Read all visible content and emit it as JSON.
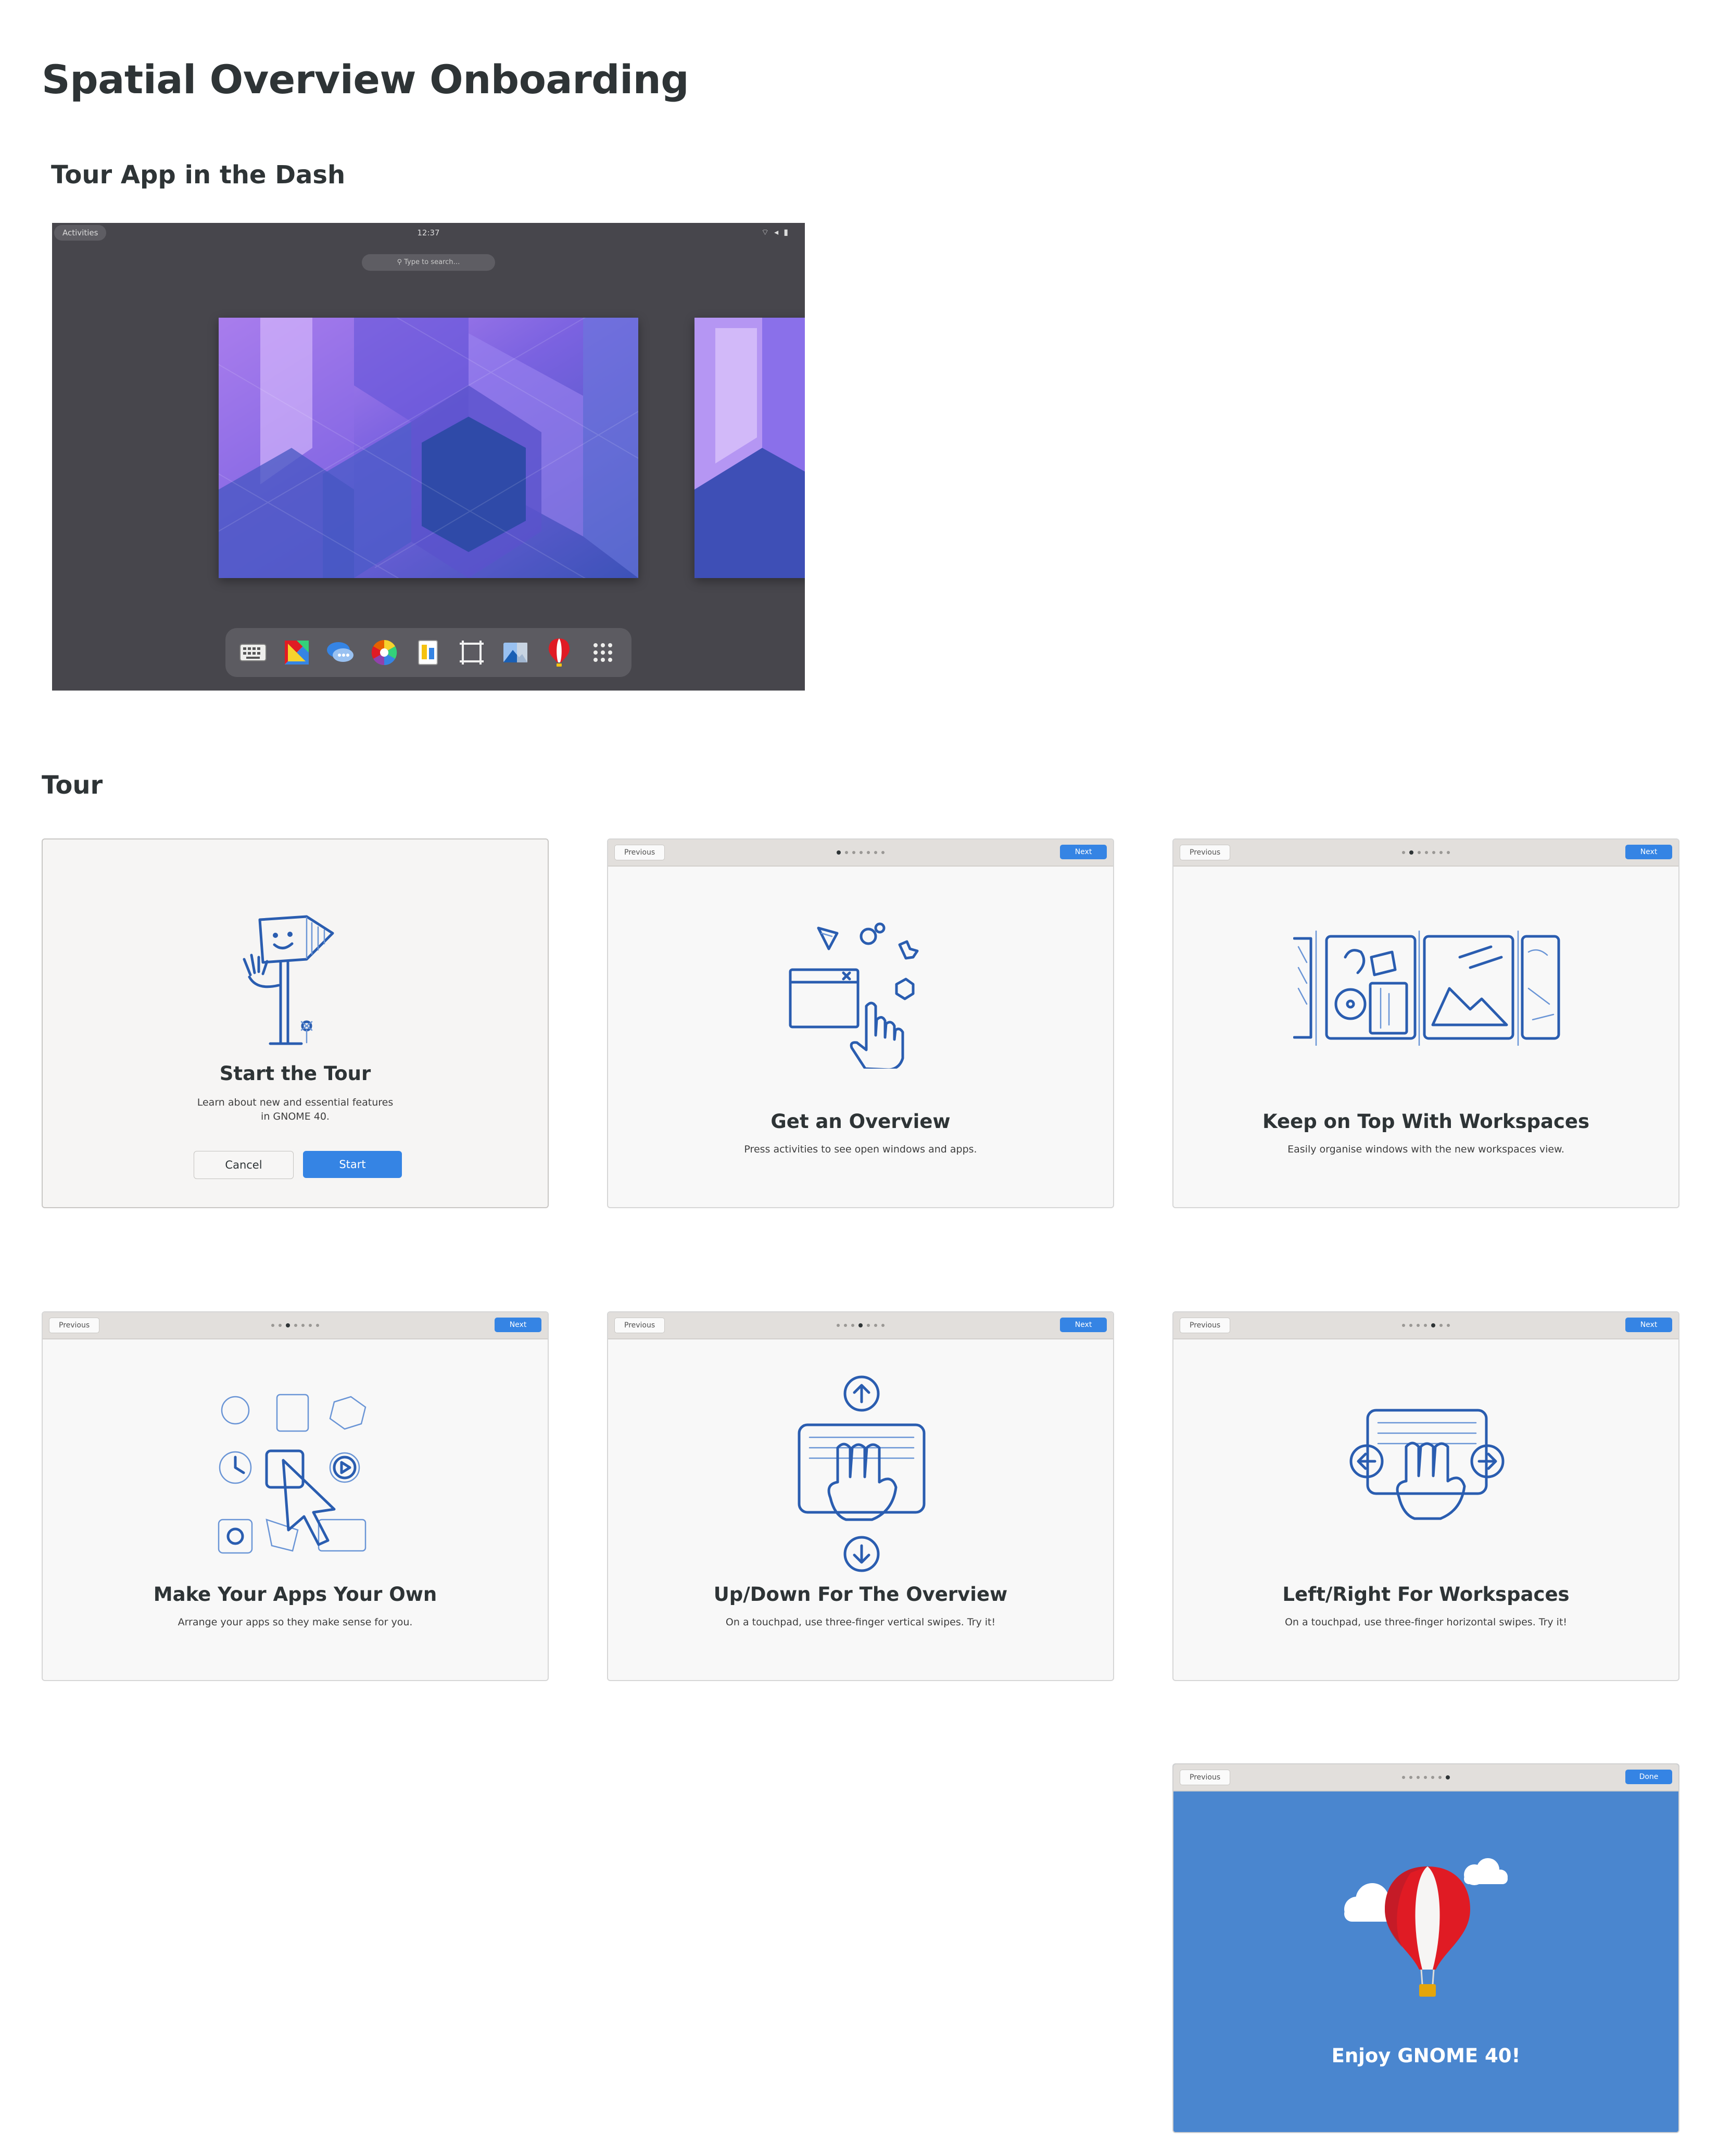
{
  "page_title": "Spatial Overview Onboarding",
  "section_dash": "Tour App  in the Dash",
  "section_tour": "Tour",
  "overview": {
    "activities": "Activities",
    "clock": "12:37",
    "search_placeholder": "Type to search…",
    "dash_icons": [
      "keyboard-icon",
      "color-tiles-icon",
      "chat-icon",
      "color-wheel-icon",
      "document-viewer-icon",
      "screenshot-frame-icon",
      "image-viewer-icon",
      "balloon-tour-icon",
      "app-grid-icon"
    ]
  },
  "tour": {
    "start": {
      "title": "Start the Tour",
      "line1": "Learn about new and essential features",
      "line2": "in GNOME 40.",
      "cancel": "Cancel",
      "start": "Start"
    },
    "nav": {
      "previous": "Previous",
      "next": "Next",
      "done": "Done"
    },
    "pages": [
      {
        "title": "Get an Overview",
        "subtitle": "Press activities to see open windows and apps."
      },
      {
        "title": "Keep on Top With Workspaces",
        "subtitle": "Easily organise windows with the new workspaces view."
      },
      {
        "title": "Make Your Apps Your Own",
        "subtitle": "Arrange your apps so they make sense for you."
      },
      {
        "title": "Up/Down For The Overview",
        "subtitle": "On a touchpad, use three-finger vertical swipes. Try it!"
      },
      {
        "title": "Left/Right For Workspaces",
        "subtitle": "On a touchpad, use three-finger horizontal swipes. Try it!"
      },
      {
        "title": "Enjoy GNOME 40!"
      }
    ]
  },
  "colors": {
    "accent": "#3584e4",
    "final_bg": "#4a86cf",
    "sketch": "#2a5db0"
  }
}
